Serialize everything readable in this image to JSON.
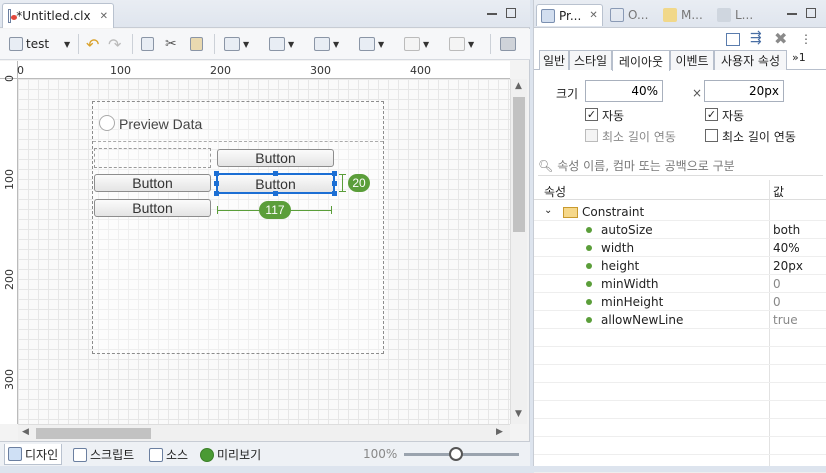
{
  "editor": {
    "tab_title": "*Untitled.clx",
    "toolbar": {
      "platform": "test"
    },
    "ruler_h": [
      "0",
      "100",
      "200",
      "300",
      "400"
    ],
    "ruler_v": [
      "0",
      "100",
      "200",
      "300"
    ],
    "canvas": {
      "preview_label": "Preview Data",
      "buttons": [
        "Button",
        "Button",
        "Button",
        "Button"
      ],
      "height_badge": "20",
      "width_badge": "117"
    },
    "bottom_tabs": [
      "디자인",
      "스크립트",
      "소스",
      "미리보기"
    ],
    "zoom": "100%",
    "zoom_slider": 0.45
  },
  "props": {
    "view_tabs": [
      "Pr...",
      "O...",
      "M...",
      "L..."
    ],
    "sub_tabs": [
      "일반",
      "스타일",
      "레이아웃",
      "이벤트",
      "사용자 속성"
    ],
    "more_tabs": "»1",
    "size_label": "크기",
    "width_value": "40%",
    "times": "×",
    "height_value": "20px",
    "auto_w": "자동",
    "auto_h": "자동",
    "min_w": "최소 길이 연동",
    "min_h": "최소 길이 연동",
    "search_placeholder": "속성 이름, 컴마 또는 공백으로 구분",
    "col_name": "속성",
    "col_value": "값",
    "group": "Constraint",
    "rows": [
      {
        "name": "autoSize",
        "value": "both"
      },
      {
        "name": "width",
        "value": "40%"
      },
      {
        "name": "height",
        "value": "20px"
      },
      {
        "name": "minWidth",
        "value": "0"
      },
      {
        "name": "minHeight",
        "value": "0"
      },
      {
        "name": "allowNewLine",
        "value": "true"
      }
    ]
  }
}
